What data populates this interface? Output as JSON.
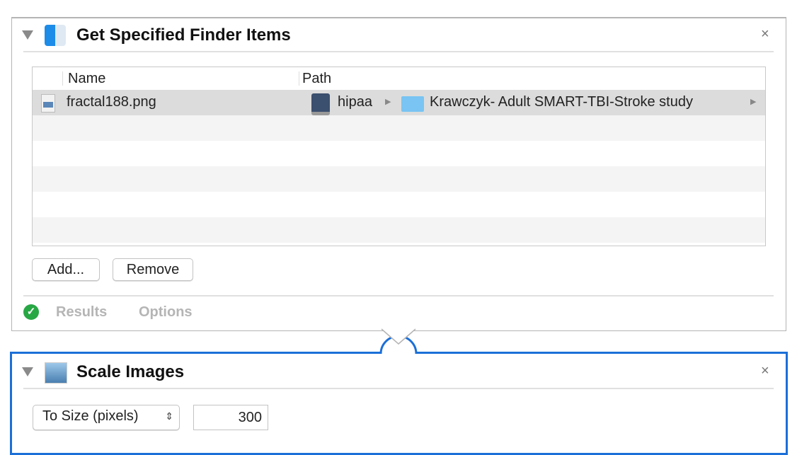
{
  "action1": {
    "title": "Get Specified Finder Items",
    "close": "×",
    "columns": {
      "name": "Name",
      "path": "Path"
    },
    "rows": [
      {
        "name": "fractal188.png",
        "path": [
          "hipaa",
          "Krawczyk- Adult SMART-TBI-Stroke study"
        ]
      }
    ],
    "buttons": {
      "add": "Add...",
      "remove": "Remove"
    },
    "tabs": {
      "results": "Results",
      "options": "Options"
    },
    "status_color": "#28a745"
  },
  "action2": {
    "title": "Scale Images",
    "close": "×",
    "mode": "To Size (pixels)",
    "size": "300",
    "accent": "#1b6fd8"
  }
}
